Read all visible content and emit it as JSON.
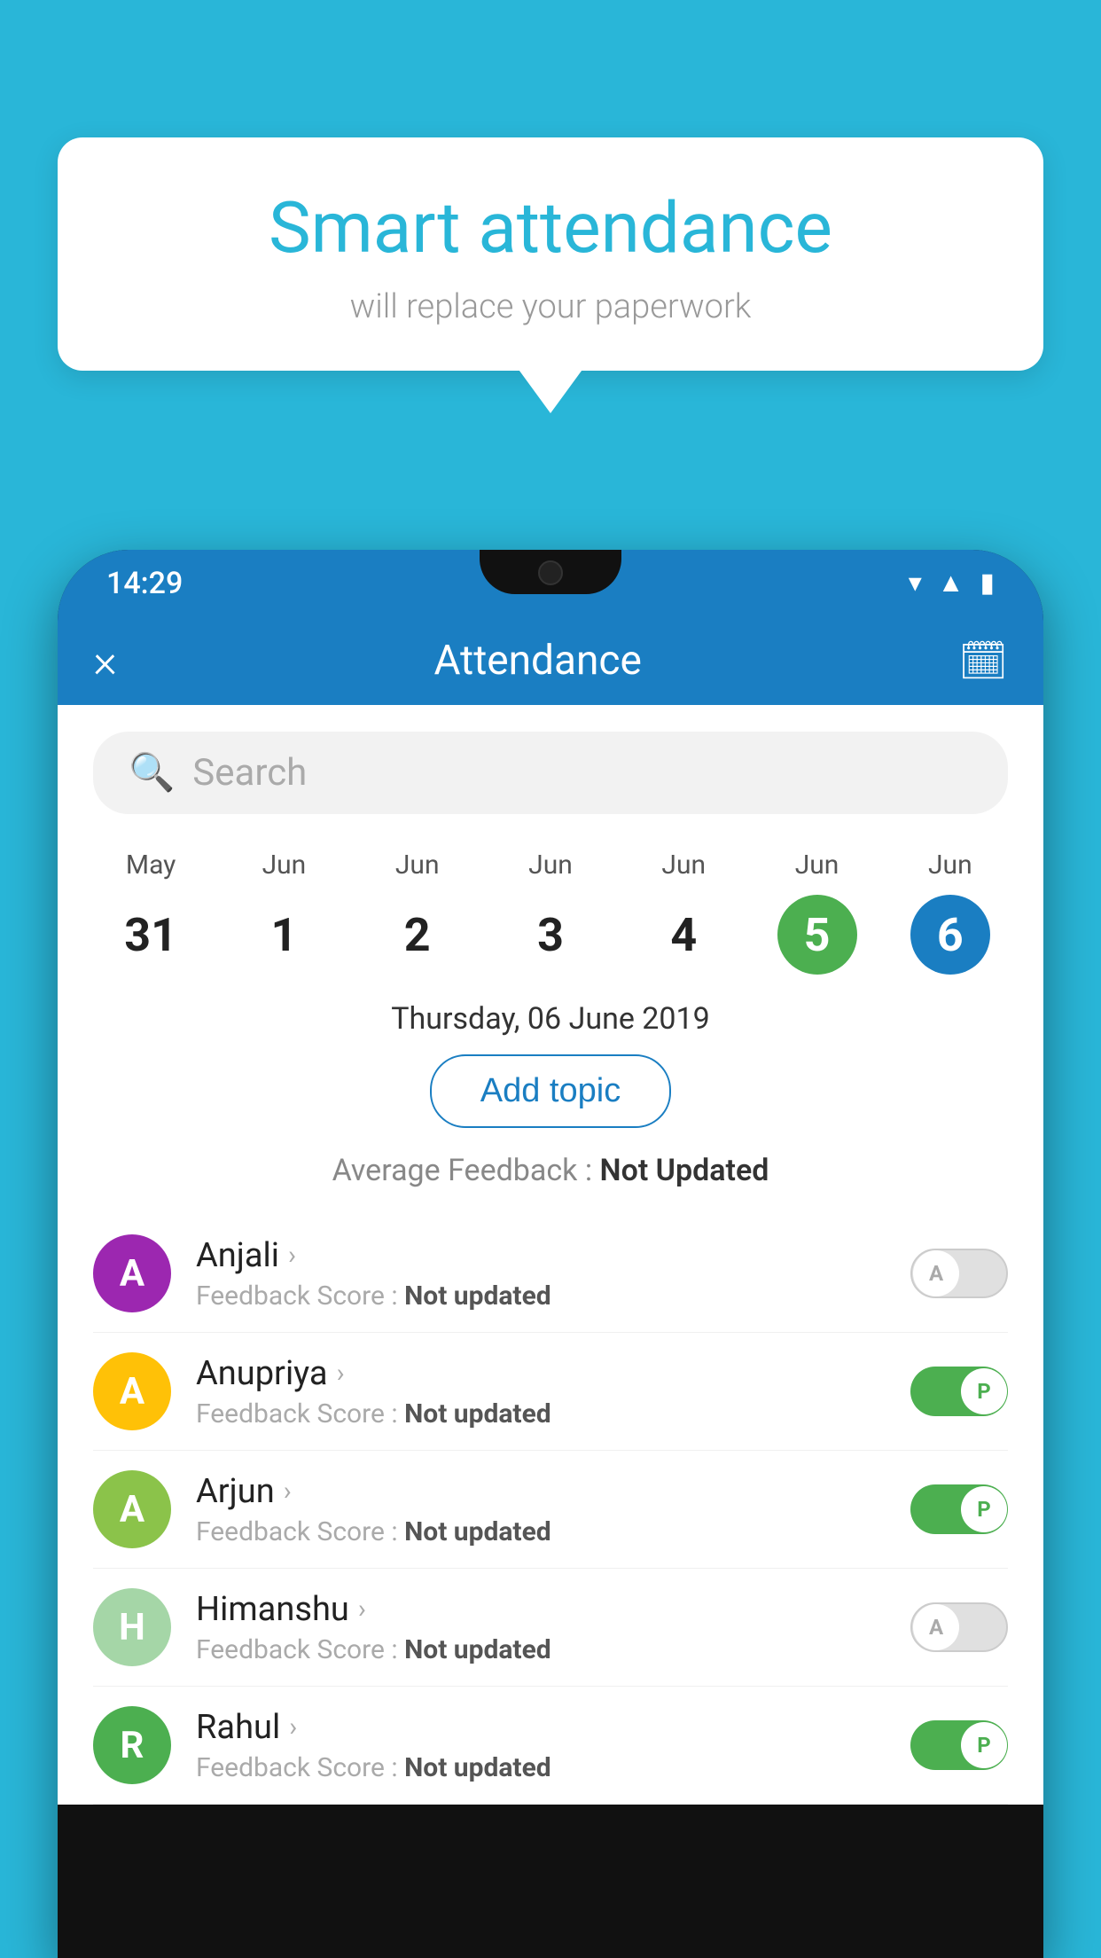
{
  "background": {
    "color": "#29b6d8"
  },
  "speech_bubble": {
    "title": "Smart attendance",
    "subtitle": "will replace your paperwork"
  },
  "phone": {
    "status_bar": {
      "time": "14:29",
      "icons": [
        "wifi",
        "signal",
        "battery"
      ]
    },
    "header": {
      "title": "Attendance",
      "close_label": "×",
      "calendar_icon": "📅"
    },
    "search": {
      "placeholder": "Search"
    },
    "dates": [
      {
        "month": "May",
        "day": "31",
        "state": "normal"
      },
      {
        "month": "Jun",
        "day": "1",
        "state": "normal"
      },
      {
        "month": "Jun",
        "day": "2",
        "state": "normal"
      },
      {
        "month": "Jun",
        "day": "3",
        "state": "normal"
      },
      {
        "month": "Jun",
        "day": "4",
        "state": "normal"
      },
      {
        "month": "Jun",
        "day": "5",
        "state": "today"
      },
      {
        "month": "Jun",
        "day": "6",
        "state": "selected"
      }
    ],
    "selected_date_label": "Thursday, 06 June 2019",
    "add_topic_label": "Add topic",
    "avg_feedback_label": "Average Feedback : ",
    "avg_feedback_value": "Not Updated",
    "students": [
      {
        "name": "Anjali",
        "initial": "A",
        "avatar_color": "#9c27b0",
        "feedback": "Not updated",
        "toggle": "off",
        "toggle_label": "A"
      },
      {
        "name": "Anupriya",
        "initial": "A",
        "avatar_color": "#ffc107",
        "feedback": "Not updated",
        "toggle": "on",
        "toggle_label": "P"
      },
      {
        "name": "Arjun",
        "initial": "A",
        "avatar_color": "#8bc34a",
        "feedback": "Not updated",
        "toggle": "on",
        "toggle_label": "P"
      },
      {
        "name": "Himanshu",
        "initial": "H",
        "avatar_color": "#a5d6a7",
        "feedback": "Not updated",
        "toggle": "off",
        "toggle_label": "A"
      },
      {
        "name": "Rahul",
        "initial": "R",
        "avatar_color": "#4caf50",
        "feedback": "Not updated",
        "toggle": "on",
        "toggle_label": "P"
      }
    ]
  }
}
